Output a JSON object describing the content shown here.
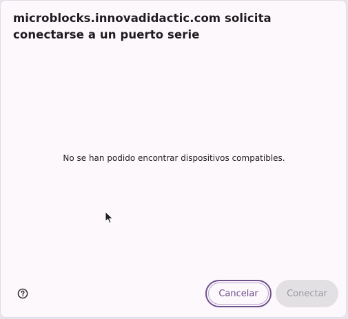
{
  "dialog": {
    "title": "microblocks.innovadidactic.com solicita conectarse a un puerto serie",
    "message": "No se han podido encontrar dispositivos compatibles.",
    "buttons": {
      "cancel_label": "Cancelar",
      "connect_label": "Conectar"
    },
    "icons": {
      "help": "help-circle-icon",
      "cursor": "mouse-pointer-icon"
    },
    "colors": {
      "accent": "#6d4f8d",
      "disabled_bg": "#e3e0e4",
      "disabled_text": "#9b97a0",
      "surface": "#fdf8fc"
    }
  }
}
